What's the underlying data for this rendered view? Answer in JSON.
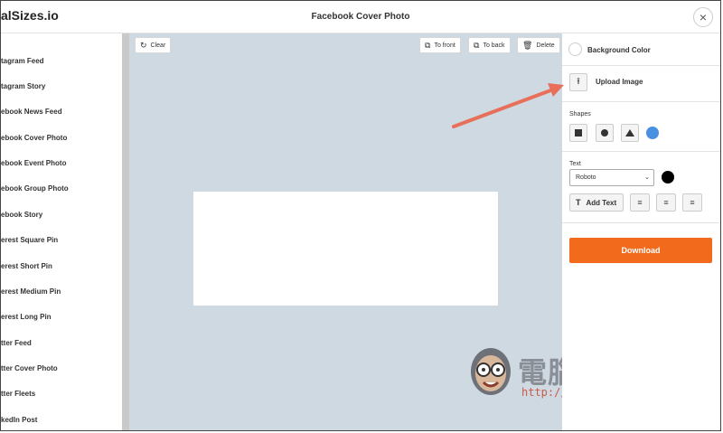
{
  "header": {
    "logo": "alSizes.io",
    "title": "Facebook Cover Photo",
    "close_icon": "×"
  },
  "sidebar": {
    "items": [
      {
        "label": "tagram Feed"
      },
      {
        "label": "tagram Story"
      },
      {
        "label": "ebook News Feed"
      },
      {
        "label": "ebook Cover Photo"
      },
      {
        "label": "ebook Event Photo"
      },
      {
        "label": "ebook Group Photo"
      },
      {
        "label": "ebook Story"
      },
      {
        "label": "erest Square Pin"
      },
      {
        "label": "erest Short Pin"
      },
      {
        "label": "erest Medium Pin"
      },
      {
        "label": "erest Long Pin"
      },
      {
        "label": "tter Feed"
      },
      {
        "label": "tter Cover Photo"
      },
      {
        "label": "tter Fleets"
      },
      {
        "label": "kedIn Post"
      }
    ]
  },
  "toolbar": {
    "clear": "Clear",
    "to_front": "To front",
    "to_back": "To back",
    "delete": "Delete"
  },
  "panel": {
    "background_color": "Background Color",
    "upload_image": "Upload Image",
    "shapes_title": "Shapes",
    "text_title": "Text",
    "font_value": "Roboto",
    "add_text": "Add Text",
    "download": "Download"
  },
  "watermark": {
    "title": "電腦王阿達",
    "url": "http://www.kocpc.com.tw"
  },
  "colors": {
    "download": "#f26a1b",
    "canvas_bg": "#cfd9e2",
    "shape_color": "#4a90e2",
    "text_color": "#000000",
    "arrow": "#e8705a"
  }
}
